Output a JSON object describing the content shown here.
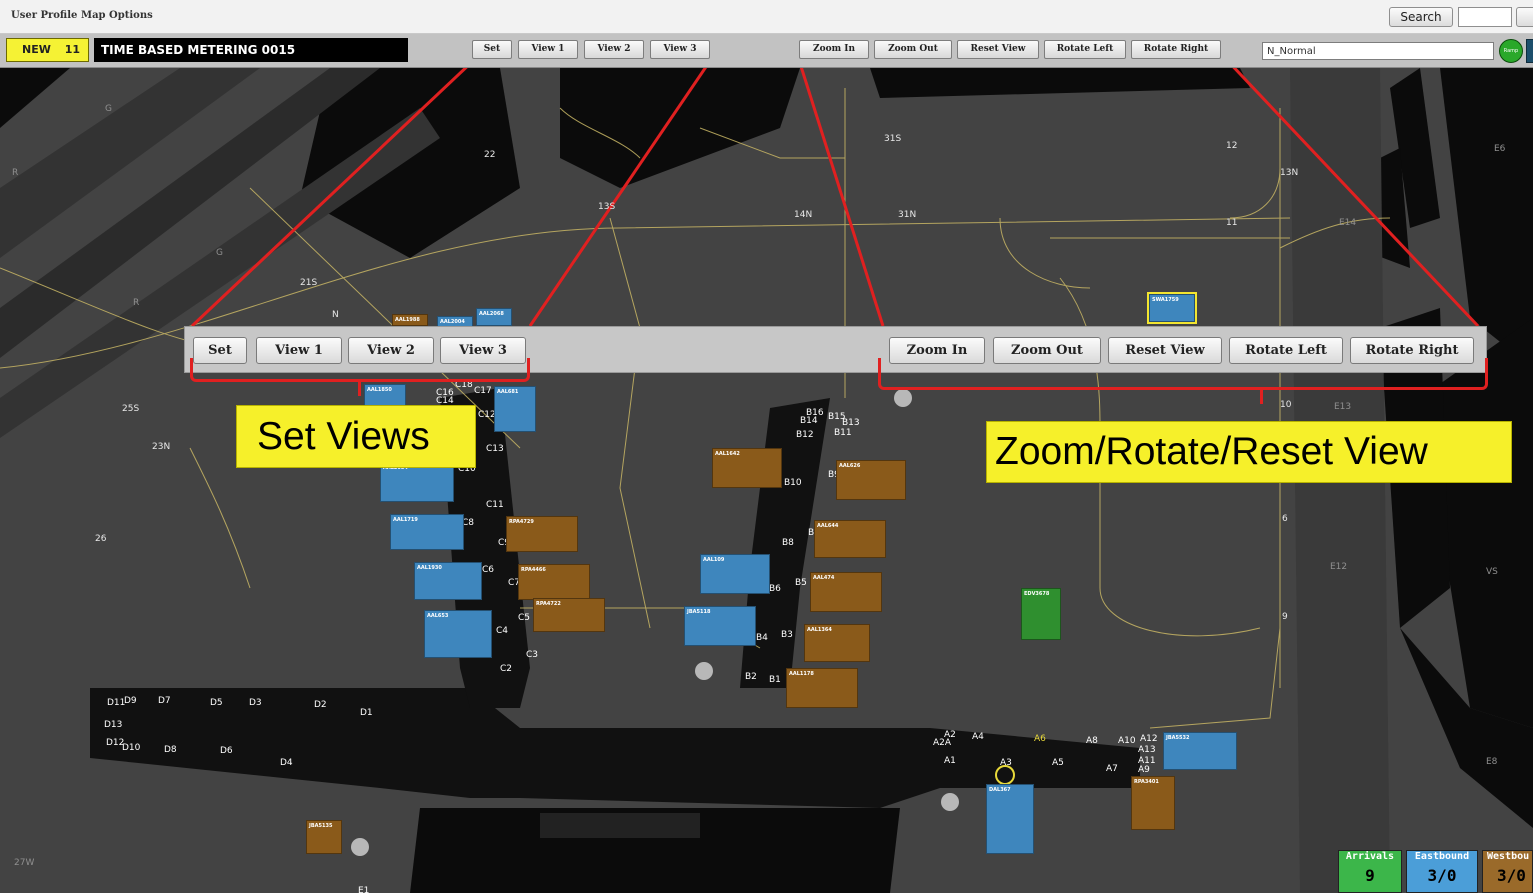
{
  "menu": {
    "user_profile": "User Profile",
    "map_options": "Map Options",
    "search_label": "Search"
  },
  "toolbar": {
    "new_label": "NEW",
    "new_count": "11",
    "metering_title": "TIME BASED METERING 0015",
    "set_label": "Set",
    "view1_label": "View 1",
    "view2_label": "View 2",
    "view3_label": "View 3",
    "zoom_in_label": "Zoom In",
    "zoom_out_label": "Zoom Out",
    "reset_view_label": "Reset View",
    "rotate_left_label": "Rotate Left",
    "rotate_right_label": "Rotate Right",
    "mode_value": "N_Normal",
    "status_label": "Ramp"
  },
  "callout": {
    "set_label": "Set",
    "view1_label": "View 1",
    "view2_label": "View 2",
    "view3_label": "View 3",
    "zoom_in_label": "Zoom In",
    "zoom_out_label": "Zoom Out",
    "reset_view_label": "Reset View",
    "rotate_left_label": "Rotate Left",
    "rotate_right_label": "Rotate Right",
    "set_views_caption": "Set Views",
    "zoom_caption": "Zoom/Rotate/Reset View"
  },
  "counters": {
    "arrivals_label": "Arrivals",
    "arrivals_value": "9",
    "eastbound_label": "Eastbound",
    "eastbound_value": "3/0",
    "westbound_label": "Westbou",
    "westbound_value": "3/0"
  },
  "map": {
    "runway_labels": [
      "G",
      "R",
      "G",
      "R",
      "E6",
      "E14",
      "E13",
      "E12",
      "VS",
      "E8",
      "27W"
    ],
    "taxiway_labels": [
      "22",
      "31S",
      "14N",
      "31N",
      "13S",
      "12",
      "11",
      "10",
      "6",
      "9",
      "21S",
      "25S",
      "23N",
      "26",
      "N",
      "13N"
    ],
    "gate_labels": [
      "C18",
      "C17",
      "C16",
      "C14",
      "C12",
      "C13",
      "C10",
      "C11",
      "C8",
      "C9",
      "C6",
      "C7",
      "C5",
      "C4",
      "C3",
      "C2",
      "B16",
      "B14",
      "B15",
      "B13",
      "B12",
      "B11",
      "B10",
      "B9",
      "B8",
      "B7",
      "B6",
      "B5",
      "B4",
      "B3",
      "B2",
      "B1",
      "D11",
      "D9",
      "D7",
      "D5",
      "D3",
      "D2",
      "D1",
      "D13",
      "D12",
      "D10",
      "D8",
      "D6",
      "D4",
      "A2",
      "A2A",
      "A4",
      "A6",
      "A8",
      "A10",
      "A12",
      "A13",
      "A11",
      "A9",
      "A1",
      "A3",
      "A5",
      "A7",
      "E1"
    ],
    "flights": [
      "AAL1988",
      "AAL2004",
      "AAL2068",
      "AAL681",
      "AAL1850",
      "AAL2034",
      "AAL1719",
      "AAL1930",
      "RPA4729",
      "RPA4466",
      "RPA4722",
      "AAL653",
      "AAL1642",
      "AAL626",
      "AAL644",
      "AAL474",
      "AAL1364",
      "AAL1178",
      "AAL109",
      "JBA5118",
      "SWA1759",
      "EDV3678",
      "DAL367",
      "RPA3401",
      "JBA5532",
      "JBA5135"
    ]
  },
  "colors": {
    "accent_red": "#e02020",
    "caption_yellow": "#f6f02a",
    "arrivals_green": "#3cb64a",
    "eastbound_blue": "#4b9ed8",
    "westbound_brown": "#9a6a2a"
  }
}
